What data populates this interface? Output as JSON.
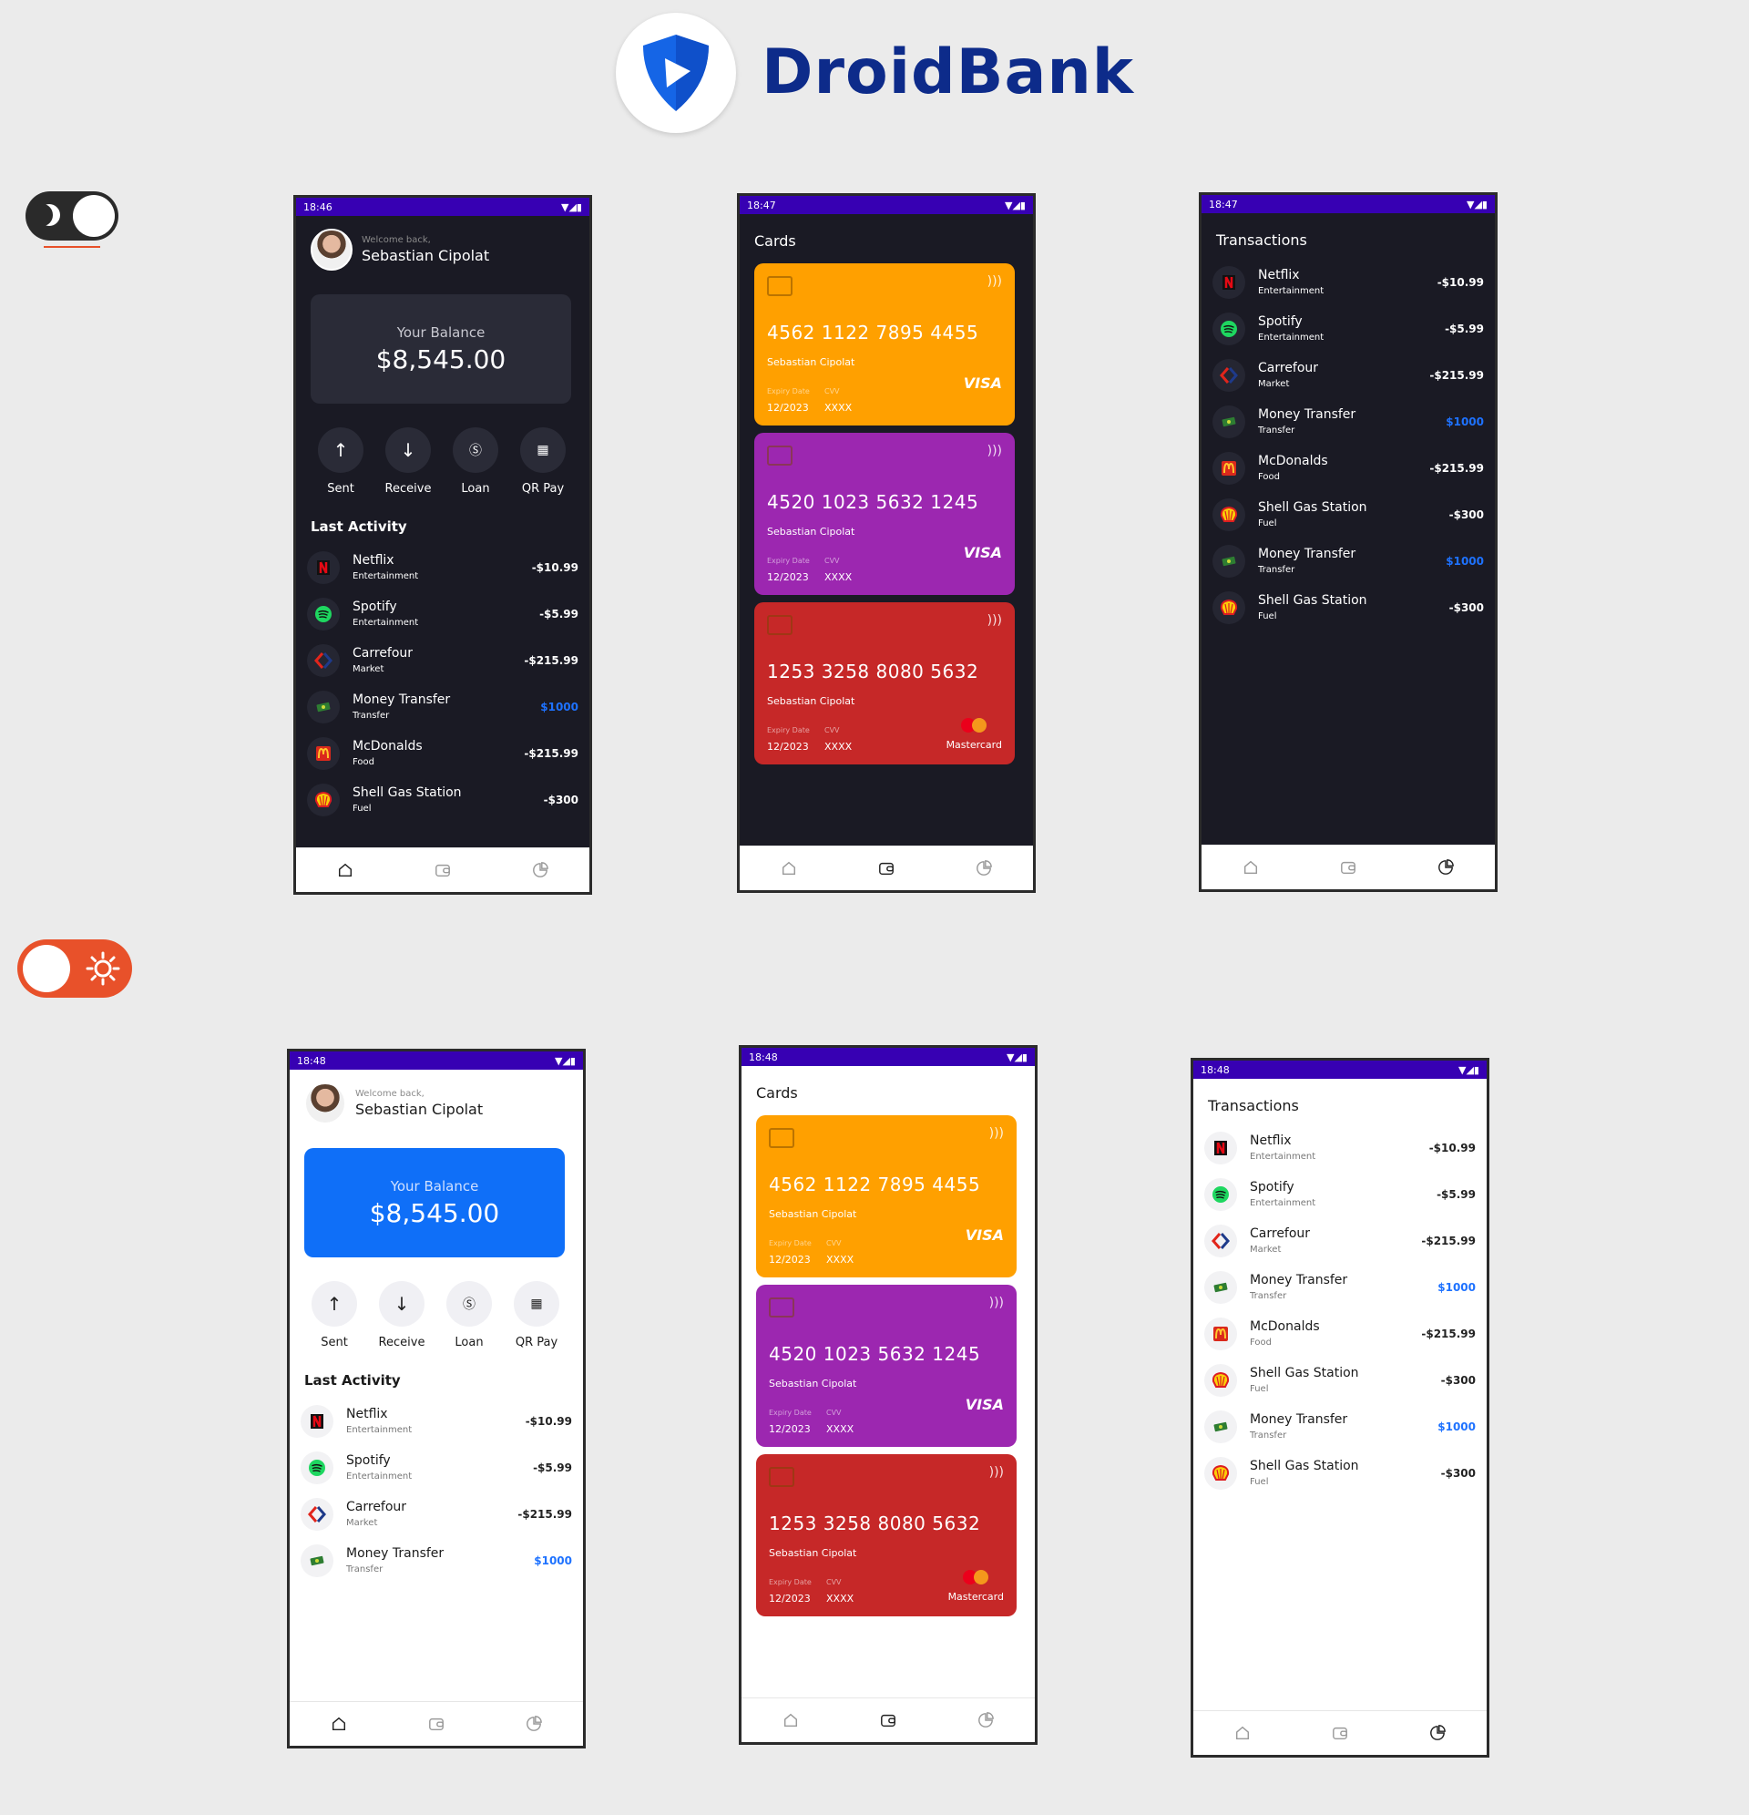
{
  "brand": {
    "name": "DroidBank"
  },
  "user": {
    "welcome": "Welcome back,",
    "name": "Sebastian Cipolat"
  },
  "balance": {
    "label": "Your Balance",
    "value": "$8,545.00"
  },
  "actions": [
    {
      "label": "Sent",
      "icon": "arrow-up-icon"
    },
    {
      "label": "Receive",
      "icon": "arrow-down-icon"
    },
    {
      "label": "Loan",
      "icon": "dollar-circle-icon"
    },
    {
      "label": "QR Pay",
      "icon": "qr-icon"
    }
  ],
  "sections": {
    "last_activity": "Last Activity",
    "cards": "Cards",
    "transactions": "Transactions"
  },
  "status_times": {
    "dark_home": "18:46",
    "dark_cards": "18:47",
    "dark_transactions": "18:47",
    "light_home": "18:48",
    "light_cards": "18:48",
    "light_transactions": "18:48"
  },
  "transactions": [
    {
      "title": "Netflix",
      "category": "Entertainment",
      "amount": "-$10.99",
      "icon": "netflix-icon",
      "positive": false
    },
    {
      "title": "Spotify",
      "category": "Entertainment",
      "amount": "-$5.99",
      "icon": "spotify-icon",
      "positive": false
    },
    {
      "title": "Carrefour",
      "category": "Market",
      "amount": "-$215.99",
      "icon": "carrefour-icon",
      "positive": false
    },
    {
      "title": "Money Transfer",
      "category": "Transfer",
      "amount": "$1000",
      "icon": "money-icon",
      "positive": true
    },
    {
      "title": "McDonalds",
      "category": "Food",
      "amount": "-$215.99",
      "icon": "mcdonalds-icon",
      "positive": false
    },
    {
      "title": "Shell Gas Station",
      "category": "Fuel",
      "amount": "-$300",
      "icon": "shell-icon",
      "positive": false
    },
    {
      "title": "Money Transfer",
      "category": "Transfer",
      "amount": "$1000",
      "icon": "money-icon",
      "positive": true
    },
    {
      "title": "Shell Gas Station",
      "category": "Fuel",
      "amount": "-$300",
      "icon": "shell-icon",
      "positive": false
    }
  ],
  "cards": [
    {
      "number": "4562 1122 7895 4455",
      "holder": "Sebastian Cipolat",
      "expiry_label": "Expiry Date",
      "cvv_label": "CVV",
      "expiry": "12/2023",
      "cvv": "XXXX",
      "brand": "VISA",
      "color": "#ffa000"
    },
    {
      "number": "4520 1023 5632 1245",
      "holder": "Sebastian Cipolat",
      "expiry_label": "Expiry Date",
      "cvv_label": "CVV",
      "expiry": "12/2023",
      "cvv": "XXXX",
      "brand": "VISA",
      "color": "#9c27b0"
    },
    {
      "number": "1253 3258 8080 5632",
      "holder": "Sebastian Cipolat",
      "expiry_label": "Expiry Date",
      "cvv_label": "CVV",
      "expiry": "12/2023",
      "cvv": "XXXX",
      "brand": "Mastercard",
      "color": "#c62828"
    }
  ],
  "colors": {
    "status_bar": "#3700b3",
    "accent_blue": "#0f6ff8",
    "toggle_orange": "#e8512a",
    "dark_bg": "#1a1a24"
  }
}
